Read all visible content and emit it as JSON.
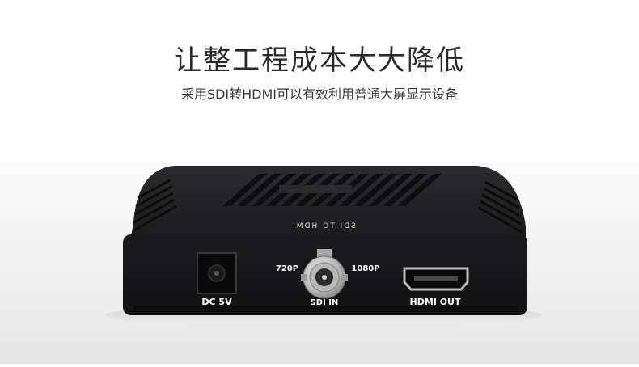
{
  "header": {
    "headline": "让整工程成本大大降低",
    "subheadline": "采用SDI转HDMI可以有效利用普通大屏显示设备"
  },
  "device": {
    "top_text": "SDI TO HDMI",
    "power_label": "DC 5V",
    "bnc_left_label": "720P",
    "bnc_right_label": "1080P",
    "bnc_bottom_label": "SDI IN",
    "hdmi_label": "HDMI OUT"
  },
  "colors": {
    "device_body": "#1d1d1f",
    "device_panel": "#141416",
    "label_text": "#ffffff",
    "metal": "#c9c9c9"
  }
}
